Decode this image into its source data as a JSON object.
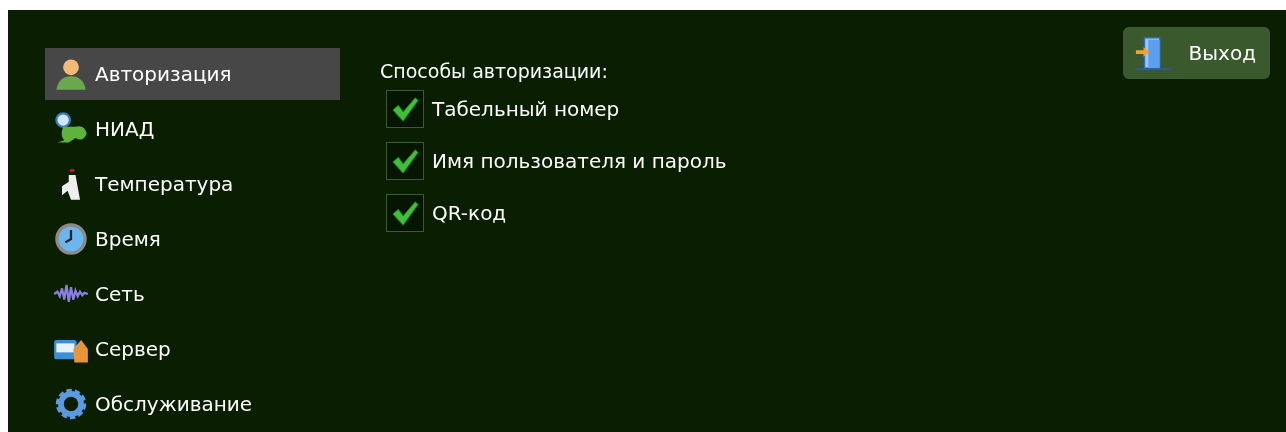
{
  "sidebar": {
    "items": [
      {
        "label": "Авторизация",
        "selected": true
      },
      {
        "label": "НИАД",
        "selected": false
      },
      {
        "label": "Температура",
        "selected": false
      },
      {
        "label": "Время",
        "selected": false
      },
      {
        "label": "Сеть",
        "selected": false
      },
      {
        "label": "Сервер",
        "selected": false
      },
      {
        "label": "Обслуживание",
        "selected": false
      }
    ]
  },
  "content": {
    "heading": "Способы авторизации:",
    "options": [
      {
        "label": "Табельный номер",
        "checked": true
      },
      {
        "label": "Имя пользователя и пароль",
        "checked": true
      },
      {
        "label": "QR-код",
        "checked": true
      }
    ]
  },
  "exit_button": {
    "label": "Выход"
  }
}
